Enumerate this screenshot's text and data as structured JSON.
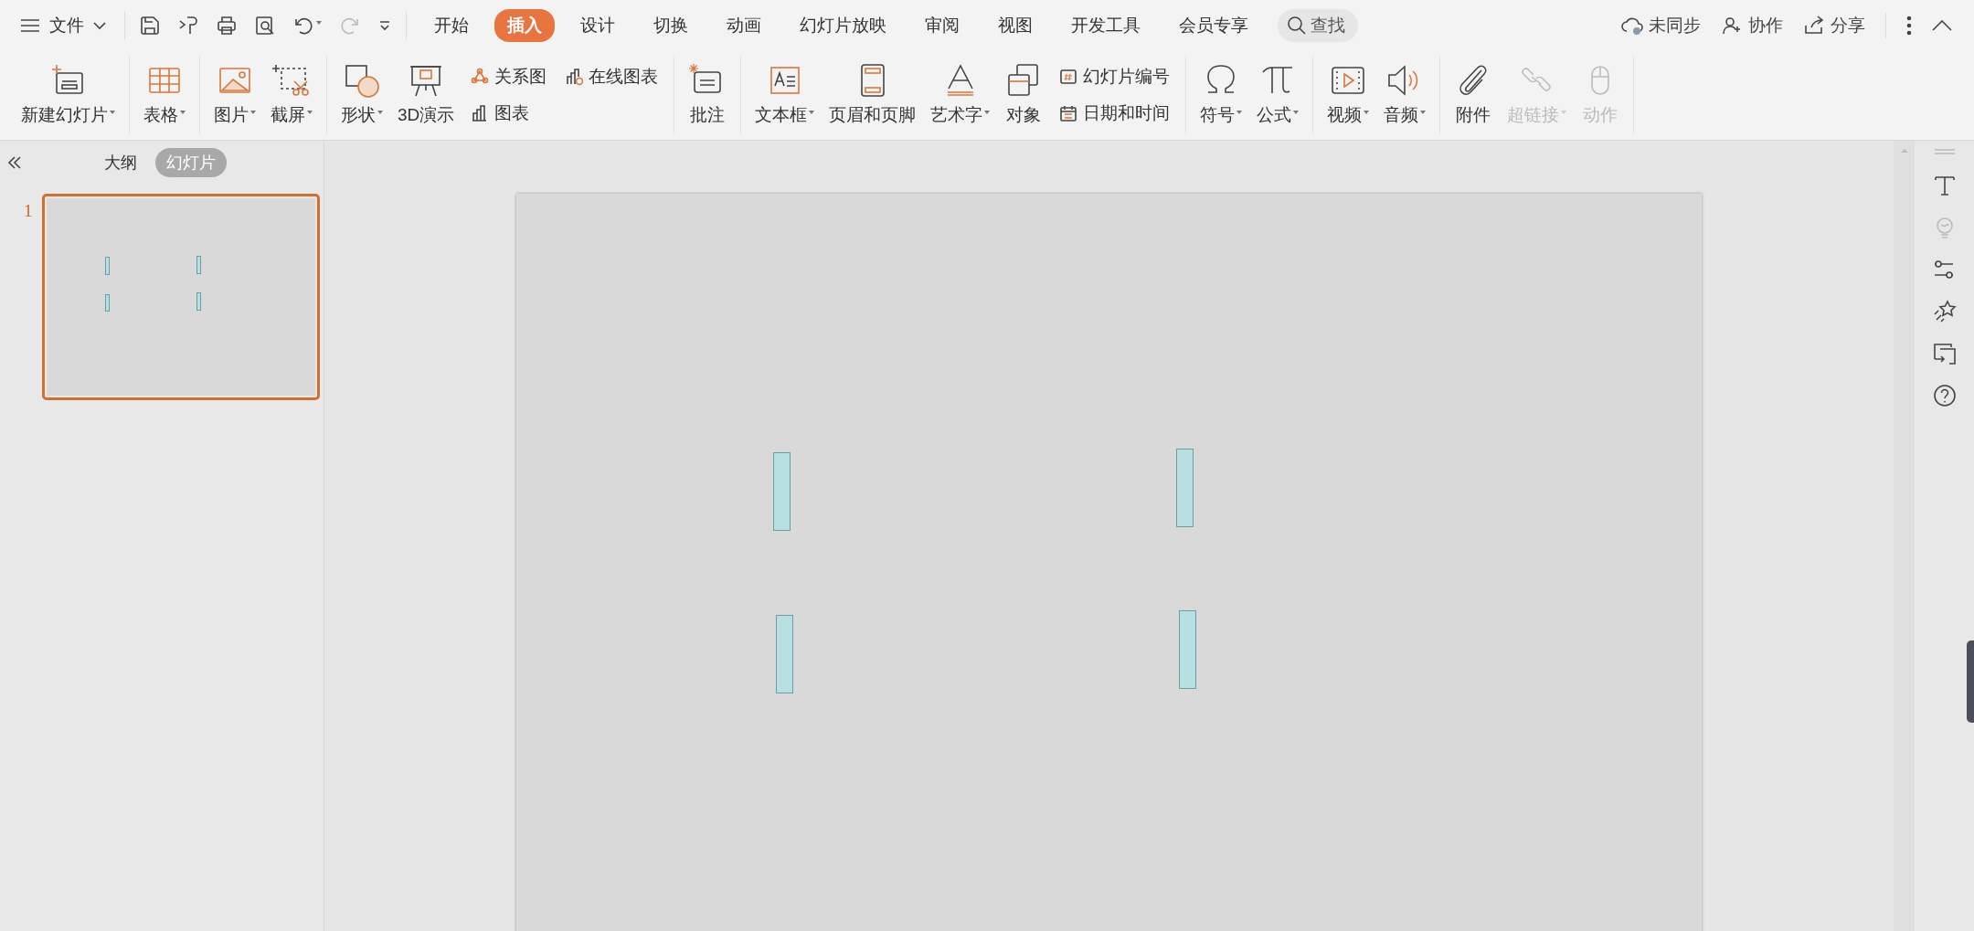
{
  "menu": {
    "label": "文件"
  },
  "tabs": [
    {
      "label": "开始",
      "selected": false
    },
    {
      "label": "插入",
      "selected": true
    },
    {
      "label": "设计",
      "selected": false
    },
    {
      "label": "切换",
      "selected": false
    },
    {
      "label": "动画",
      "selected": false
    },
    {
      "label": "幻灯片放映",
      "selected": false
    },
    {
      "label": "审阅",
      "selected": false
    },
    {
      "label": "视图",
      "selected": false
    },
    {
      "label": "开发工具",
      "selected": false
    },
    {
      "label": "会员专享",
      "selected": false
    }
  ],
  "search": {
    "label": "查找"
  },
  "account_actions": [
    {
      "label": "未同步"
    },
    {
      "label": "协作"
    },
    {
      "label": "分享"
    }
  ],
  "ribbon": {
    "groups": [
      {
        "items": [
          {
            "kind": "large",
            "label": "新建幻灯片",
            "dropdown": true,
            "disabled": false
          }
        ]
      },
      {
        "items": [
          {
            "kind": "large",
            "label": "表格",
            "dropdown": true,
            "disabled": false
          }
        ]
      },
      {
        "items": [
          {
            "kind": "large",
            "label": "图片",
            "dropdown": true,
            "disabled": false
          },
          {
            "kind": "large",
            "label": "截屏",
            "dropdown": true,
            "disabled": false
          }
        ]
      },
      {
        "items": [
          {
            "kind": "large",
            "label": "形状",
            "dropdown": true,
            "disabled": false
          },
          {
            "kind": "large",
            "label": "3D演示",
            "dropdown": false,
            "disabled": false
          },
          {
            "kind": "stack",
            "buttons": [
              {
                "label": "关系图"
              },
              {
                "label": "图表"
              }
            ]
          },
          {
            "kind": "stack",
            "buttons": [
              {
                "label": "在线图表"
              }
            ]
          }
        ]
      },
      {
        "items": [
          {
            "kind": "large",
            "label": "批注",
            "dropdown": false,
            "disabled": false
          }
        ]
      },
      {
        "items": [
          {
            "kind": "large",
            "label": "文本框",
            "dropdown": true,
            "disabled": false
          },
          {
            "kind": "large",
            "label": "页眉和页脚",
            "dropdown": false,
            "disabled": false
          },
          {
            "kind": "large",
            "label": "艺术字",
            "dropdown": true,
            "disabled": false
          },
          {
            "kind": "large",
            "label": "对象",
            "dropdown": false,
            "disabled": false
          },
          {
            "kind": "stack",
            "buttons": [
              {
                "label": "幻灯片编号"
              },
              {
                "label": "日期和时间"
              }
            ]
          }
        ]
      },
      {
        "items": [
          {
            "kind": "large",
            "label": "符号",
            "dropdown": true,
            "disabled": false
          },
          {
            "kind": "large",
            "label": "公式",
            "dropdown": true,
            "disabled": false
          }
        ]
      },
      {
        "items": [
          {
            "kind": "large",
            "label": "视频",
            "dropdown": true,
            "disabled": false
          },
          {
            "kind": "large",
            "label": "音频",
            "dropdown": true,
            "disabled": false
          }
        ]
      },
      {
        "items": [
          {
            "kind": "large",
            "label": "附件",
            "dropdown": false,
            "disabled": false
          },
          {
            "kind": "large",
            "label": "超链接",
            "dropdown": true,
            "disabled": true
          },
          {
            "kind": "large",
            "label": "动作",
            "dropdown": false,
            "disabled": true
          }
        ]
      }
    ]
  },
  "panel_tabs": [
    {
      "label": "大纲",
      "selected": false
    },
    {
      "label": "幻灯片",
      "selected": true
    }
  ],
  "slides": [
    {
      "number": "1",
      "selected": true
    }
  ],
  "slide": {
    "shapes": [
      {
        "kind": "rectangle"
      },
      {
        "kind": "rectangle"
      },
      {
        "kind": "rectangle"
      },
      {
        "kind": "rectangle"
      }
    ]
  }
}
